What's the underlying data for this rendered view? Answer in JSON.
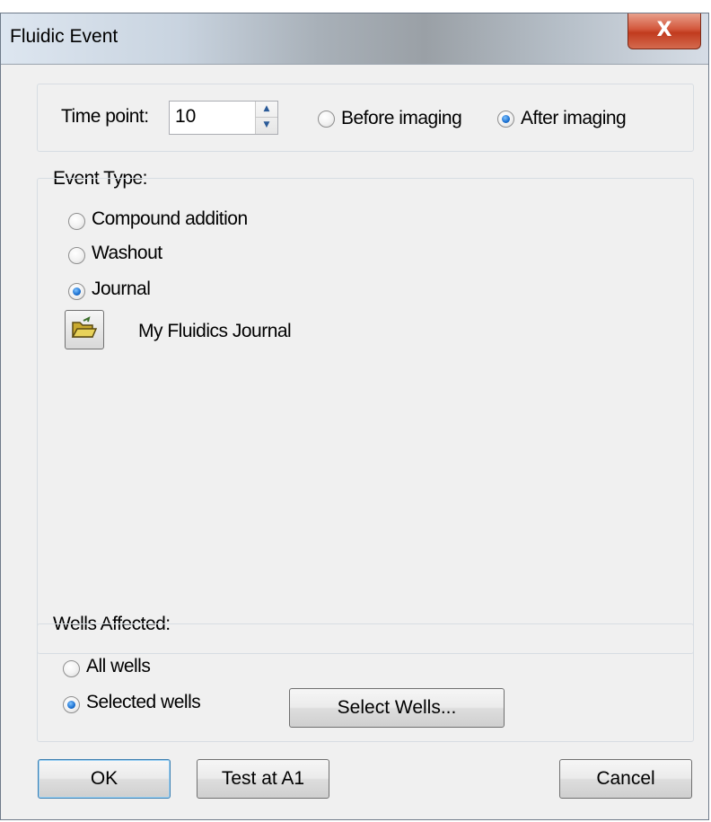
{
  "window": {
    "title": "Fluidic Event",
    "close_glyph": "X"
  },
  "time_point": {
    "label": "Time point:",
    "value": "10",
    "up_glyph": "▲",
    "down_glyph": "▼",
    "options": [
      {
        "label": "Before imaging",
        "checked": false
      },
      {
        "label": "After imaging",
        "checked": true
      }
    ]
  },
  "event_type": {
    "label": "Event Type:",
    "options": [
      {
        "label": "Compound addition",
        "checked": false
      },
      {
        "label": "Washout",
        "checked": false
      },
      {
        "label": "Journal",
        "checked": true
      }
    ],
    "journal_icon": "open-folder-icon",
    "journal_name": "My Fluidics Journal"
  },
  "wells": {
    "label": "Wells Affected:",
    "options": [
      {
        "label": "All wells",
        "checked": false
      },
      {
        "label": "Selected wells",
        "checked": true
      }
    ],
    "select_button": "Select Wells..."
  },
  "buttons": {
    "ok": "OK",
    "test": "Test at A1",
    "cancel": "Cancel"
  },
  "colors": {
    "radio_checked": "#1a6fd0",
    "close_button": "#c13b1e",
    "dialog_bg": "#f0f0f0"
  }
}
